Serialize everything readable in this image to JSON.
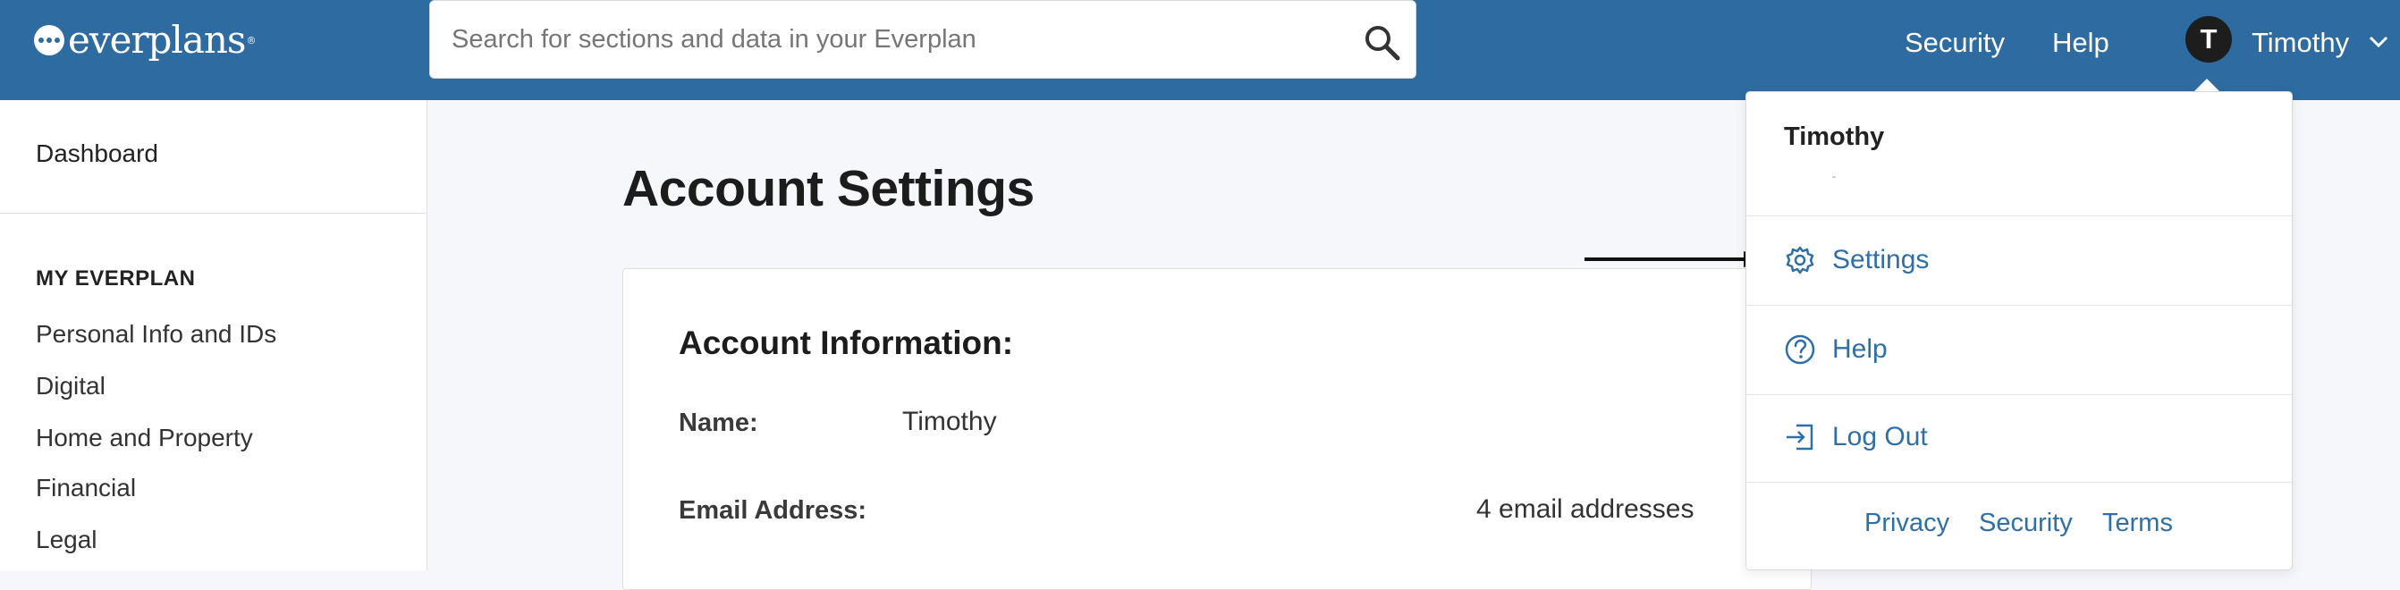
{
  "header": {
    "logo_text": "everplans",
    "logo_reg": "®",
    "search_placeholder": "Search for sections and data in your Everplan",
    "nav": {
      "security": "Security",
      "help": "Help"
    },
    "user": {
      "initial": "T",
      "name": "Timothy"
    }
  },
  "sidebar": {
    "dashboard": "Dashboard",
    "section_title": "MY EVERPLAN",
    "items": [
      "Personal Info and IDs",
      "Digital",
      "Home and Property",
      "Financial",
      "Legal"
    ]
  },
  "main": {
    "page_title": "Account Settings",
    "card": {
      "title": "Account Information:",
      "name_label": "Name:",
      "name_value": "Timothy",
      "email_label": "Email Address:",
      "email_count": "4 email addresses"
    }
  },
  "dropdown": {
    "user_name": "Timothy",
    "items": {
      "settings": "Settings",
      "help": "Help",
      "logout": "Log Out"
    },
    "footer": {
      "privacy": "Privacy",
      "security": "Security",
      "terms": "Terms"
    }
  },
  "icons": {
    "search": "search-icon",
    "chevron": "chevron-down-icon",
    "settings": "gear-icon",
    "help": "question-circle-icon",
    "logout": "logout-icon",
    "arrow": "arrow-right-icon"
  },
  "colors": {
    "brand": "#2e6ba0",
    "link": "#2f6fa8",
    "annotation_dot": "#3e9a46"
  }
}
